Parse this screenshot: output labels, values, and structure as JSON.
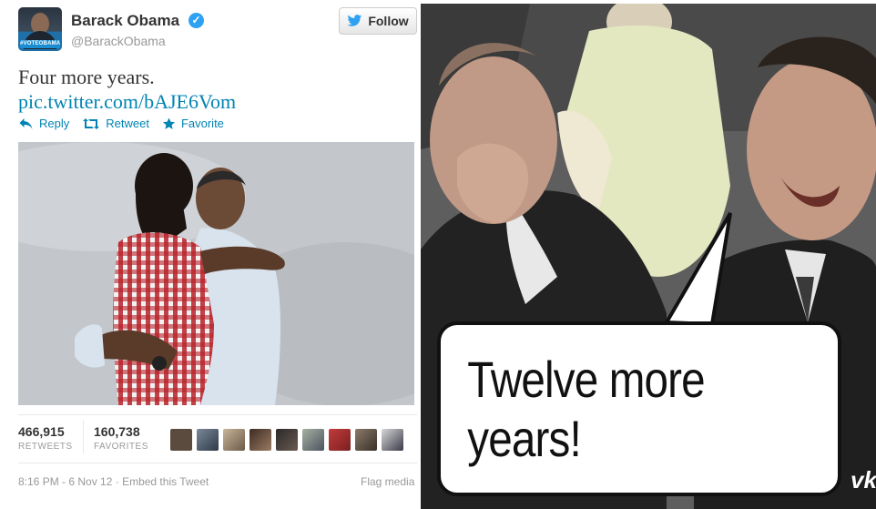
{
  "tweet": {
    "author_name": "Barack Obama",
    "author_handle": "@BarackObama",
    "avatar_tag": "#VOTEOBAMA",
    "follow_label": "Follow",
    "text": "Four more years.",
    "link": "pic.twitter.com/bAJE6Vom",
    "actions": {
      "reply": "Reply",
      "retweet": "Retweet",
      "favorite": "Favorite"
    },
    "stats": {
      "retweets_count": "466,915",
      "retweets_label": "RETWEETS",
      "favorites_count": "160,738",
      "favorites_label": "FAVORITES"
    },
    "timestamp": "8:16 PM - 6 Nov 12",
    "embed_label": "Embed this Tweet",
    "flag_label": "Flag media"
  },
  "meme": {
    "caption": "Twelve more years!",
    "watermark": "vk"
  },
  "colors": {
    "link_blue": "#0084b4",
    "verified_blue": "#2ea1f2",
    "muted_gray": "#999999"
  },
  "icons": [
    "twitter-bird-icon",
    "verified-badge-icon",
    "reply-icon",
    "retweet-icon",
    "favorite-star-icon"
  ]
}
